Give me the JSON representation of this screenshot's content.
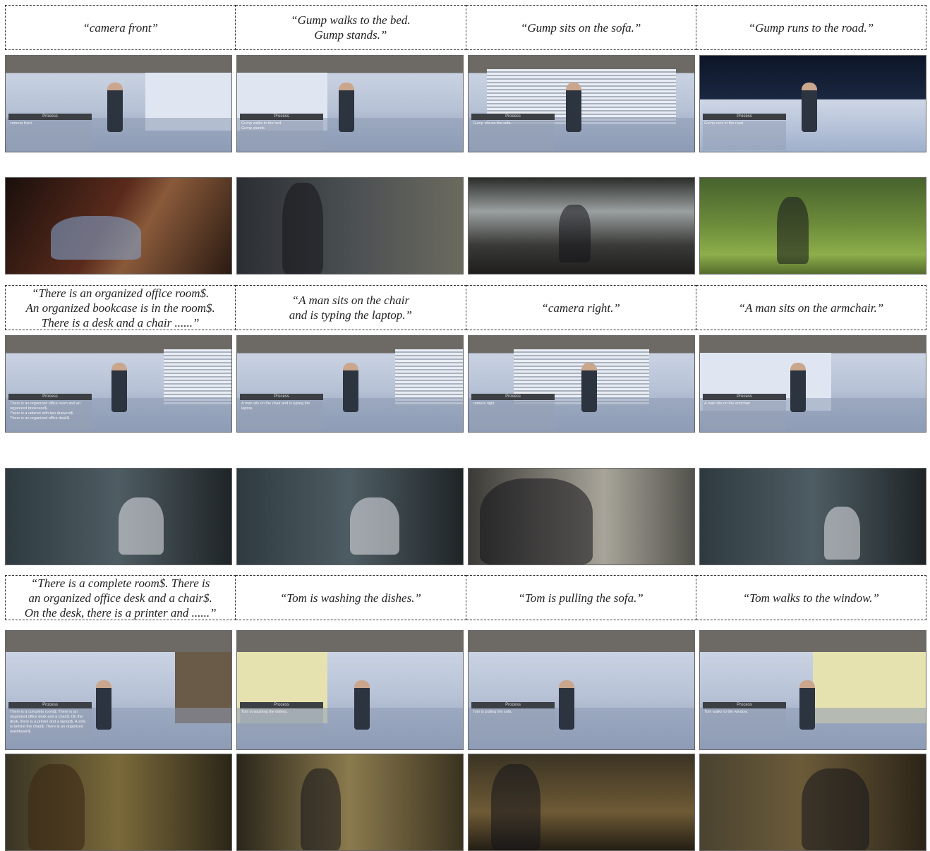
{
  "groups": [
    {
      "captions": [
        "“camera front”",
        "“Gump walks to the bed.\nGump stands.”",
        "“Gump sits on the sofa.”",
        "“Gump runs to the road.”"
      ],
      "process_label": "Process",
      "panel_texts": [
        "camera front",
        "Gump walks to the bed.\nGump stands.",
        "Gump sits on the sofa.",
        "Gump runs to the road."
      ]
    },
    {
      "captions": [
        "“There is an organized office room$.\nAn organized bookcase is in the room$.\nThere is a desk and a chair ......”",
        "“A man sits on the chair\nand is typing the laptop.”",
        "“camera right.”",
        "“A man sits on the armchair.”"
      ],
      "process_label": "Process",
      "panel_texts": [
        "There is an organized office room and an organized bookcase$.\nThere is a cabinet with two drawers$.\nThere is an organized office desk$.",
        "A man sits on the chair and is typing the laptop.",
        "camera right.",
        "A man sits on the armchair."
      ]
    },
    {
      "captions": [
        "“There is a complete room$. There is\nan organized office desk and a chair$.\nOn the desk, there is a printer and ......”",
        "“Tom is washing the dishes.”",
        "“Tom is pulling the sofa.”",
        "“Tom walks to the window.”"
      ],
      "process_label": "Process",
      "panel_texts": [
        "There is a complete room$. There is an organized office desk and a chair$. On the desk, there is a printer and a laptop$. A sofa is behind the chair$. There is an organized washbasin$.",
        "Tom is washing the dishes.",
        "Tom is pulling the sofa.",
        "Tom walks to the window."
      ]
    }
  ]
}
